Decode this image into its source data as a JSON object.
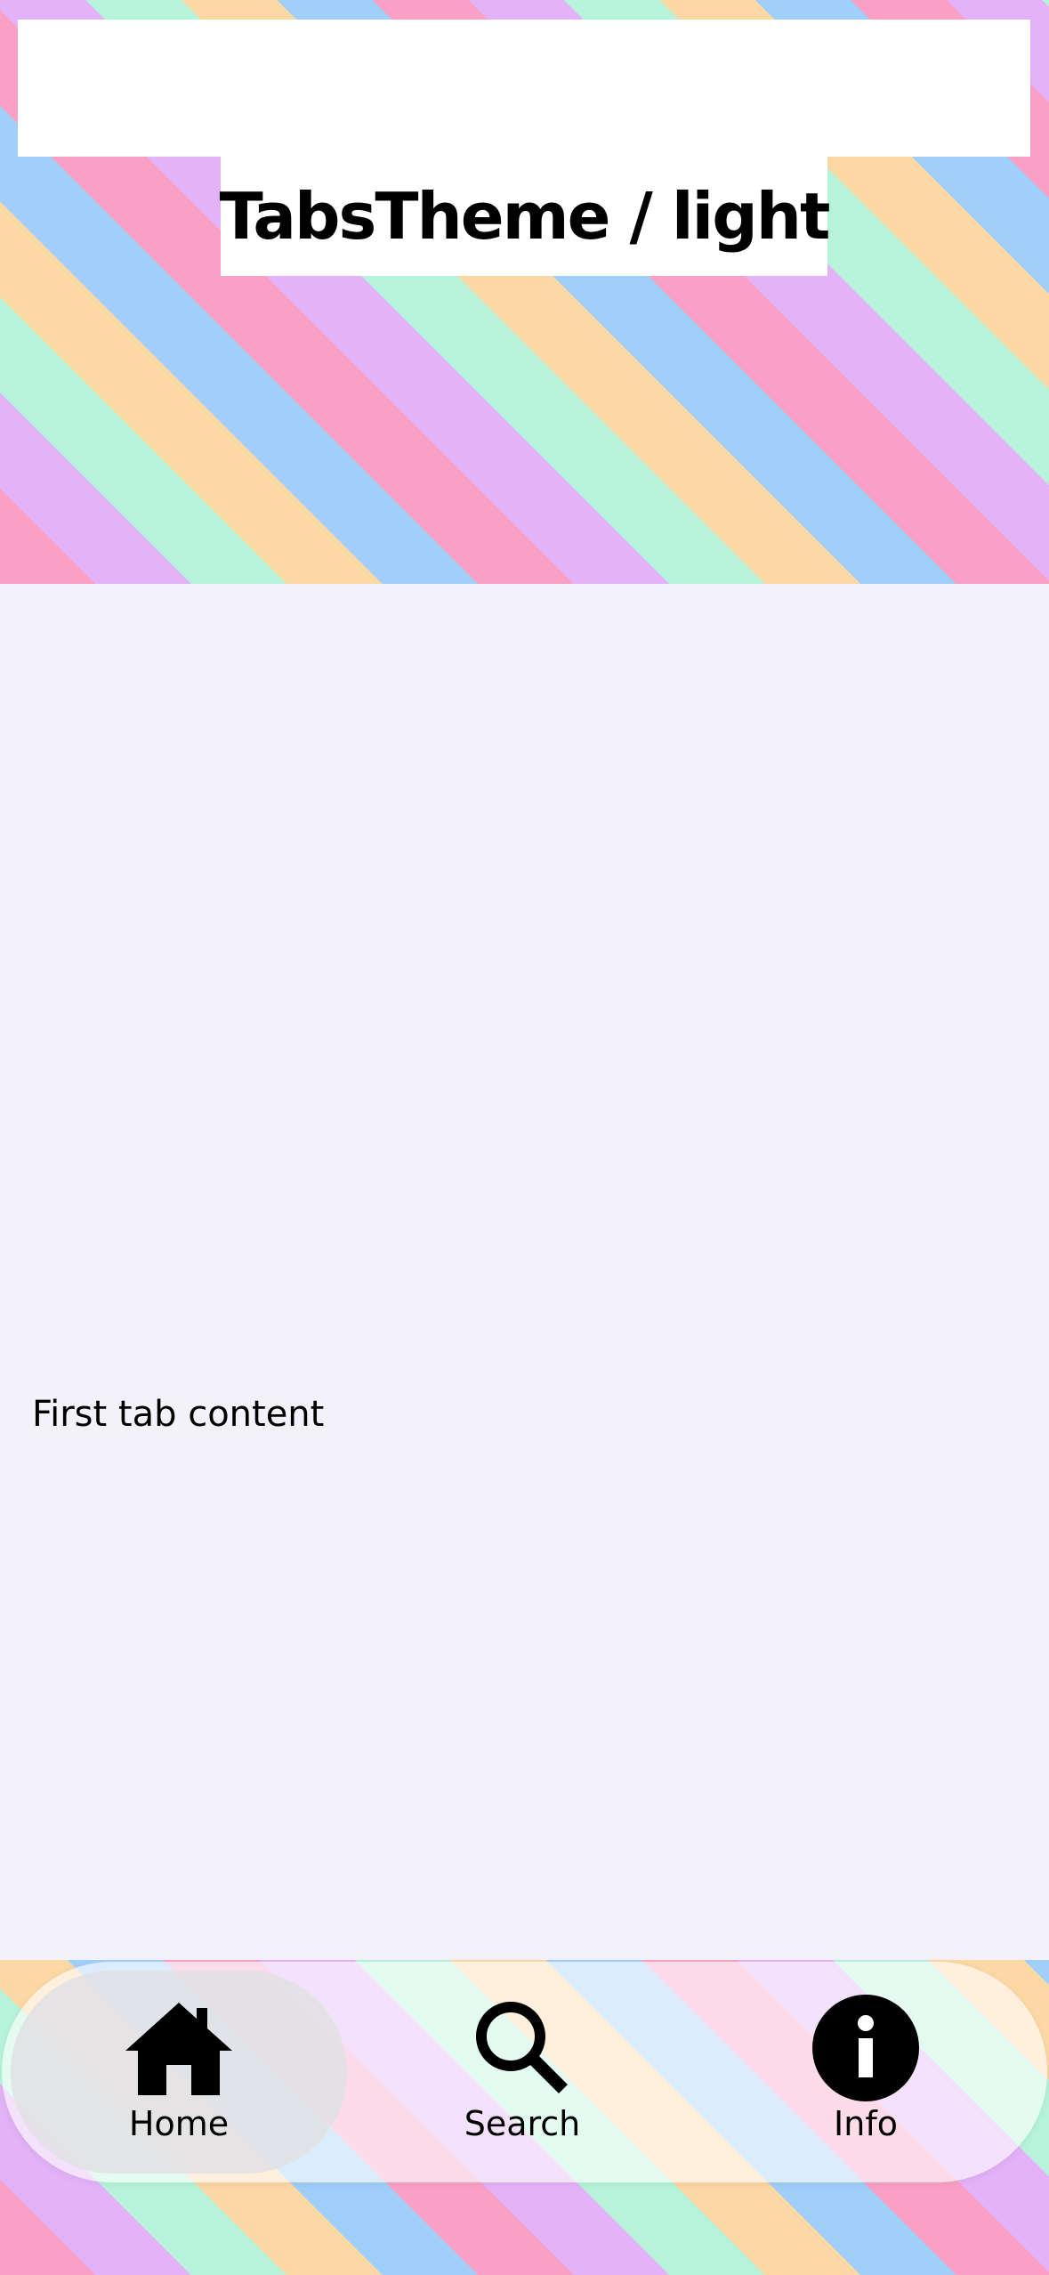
{
  "header": {
    "title": "TabsTheme / light"
  },
  "content": {
    "text": "First tab content"
  },
  "tabbar": {
    "active_tab": "Home",
    "tabs": [
      {
        "label": "Home",
        "icon": "house-icon"
      },
      {
        "label": "Search",
        "icon": "magnifying-glass-icon"
      },
      {
        "label": "Info",
        "icon": "info-circle-icon"
      }
    ]
  },
  "colors": {
    "stripes": [
      "#f9a0c4",
      "#e3b2f8",
      "#b6f3da",
      "#fbd8a4",
      "#a0cff9"
    ],
    "content_background": "#f3f2fa",
    "active_tab_pill": "#e1e1e4",
    "text": "#000000"
  }
}
